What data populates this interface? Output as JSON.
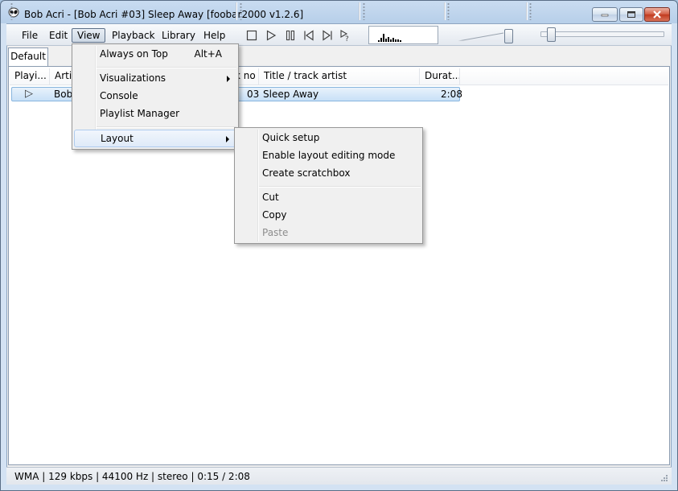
{
  "window": {
    "title": "Bob Acri - [Bob Acri #03] Sleep Away   [foobar2000 v1.2.6]",
    "icon": "foobar-alien-icon",
    "controls": [
      "minimize-icon",
      "maximize-icon",
      "close-icon"
    ]
  },
  "menubar": {
    "file": "File",
    "edit": "Edit",
    "view": "View",
    "playback": "Playback",
    "library": "Library",
    "help": "Help"
  },
  "transport": [
    "stop-icon",
    "play-icon",
    "pause-icon",
    "previous-icon",
    "next-icon",
    "random-icon"
  ],
  "tabs": [
    "Default"
  ],
  "playlist": {
    "columns": [
      "Playi...",
      "Arti",
      "k no",
      "Title / track artist",
      "Durat..."
    ],
    "rows": [
      {
        "playing": "▷",
        "artist": "Bob",
        "track_no": "03",
        "title": "Sleep Away",
        "duration": "2:08"
      }
    ]
  },
  "view_menu": {
    "items": [
      {
        "label": "Always on Top",
        "shortcut": "Alt+A"
      },
      {
        "label": "Visualizations"
      },
      {
        "label": "Console"
      },
      {
        "label": "Playlist Manager"
      },
      {
        "label": "Layout"
      }
    ]
  },
  "layout_menu": {
    "items": [
      {
        "label": "Quick setup"
      },
      {
        "label": "Enable layout editing mode"
      },
      {
        "label": "Create scratchbox"
      },
      {
        "label": "Cut"
      },
      {
        "label": "Copy"
      },
      {
        "label": "Paste"
      }
    ]
  },
  "status": {
    "text": "WMA | 129 kbps | 44100 Hz | stereo | 0:15 / 2:08"
  },
  "seek": {
    "position_fraction": 0.12
  },
  "volume": {
    "level_fraction": 1.0
  },
  "colors": {
    "selection": "#c8e0f7",
    "menu_highlight": "#dfeaf8",
    "titlebar": "#b7cfe9"
  }
}
